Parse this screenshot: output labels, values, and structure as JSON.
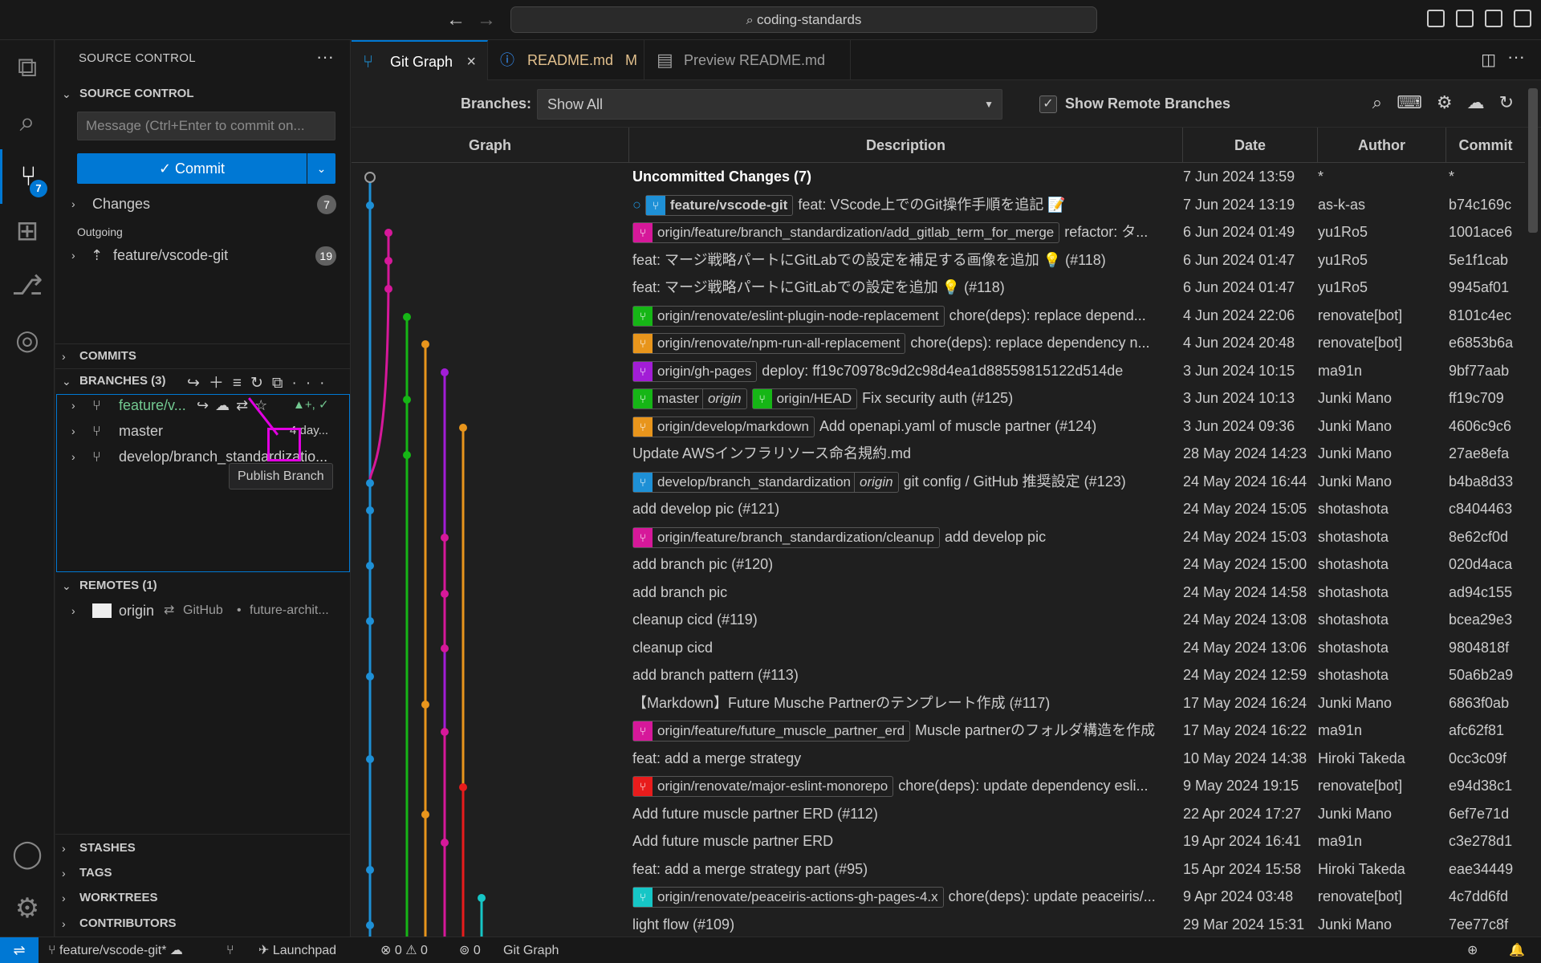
{
  "titlebar": {
    "search": "coding-standards",
    "back": "←",
    "forward": "→"
  },
  "activity": {
    "scm_badge": "7"
  },
  "sidebar": {
    "title": "SOURCE CONTROL",
    "more": "···",
    "section_source_control": "SOURCE CONTROL",
    "message_placeholder": "Message (Ctrl+Enter to commit on...",
    "commit_label": "✓ Commit",
    "changes_label": "Changes",
    "changes_count": "7",
    "outgoing_label": "Outgoing",
    "outgoing_branch": "feature/vscode-git",
    "outgoing_count": "19",
    "commits_label": "COMMITS",
    "branches_label": "BRANCHES (3)",
    "branches": [
      {
        "name": "feature/v...",
        "extra": "▲+, ✓"
      },
      {
        "name": "master",
        "extra": "4 day..."
      },
      {
        "name": "develop/branch_standardizatio...",
        "extra": ""
      }
    ],
    "tooltip": "Publish Branch",
    "remotes_label": "REMOTES (1)",
    "remote_name": "origin",
    "remote_host": "GitHub",
    "remote_owner": "future-archit...",
    "stashes_label": "STASHES",
    "tags_label": "TAGS",
    "worktrees_label": "WORKTREES",
    "contributors_label": "CONTRIBUTORS"
  },
  "tabs": [
    {
      "label": "Git Graph",
      "active": true
    },
    {
      "label": "README.md",
      "modified": "M"
    },
    {
      "label": "Preview README.md"
    }
  ],
  "toolbar": {
    "branches_label": "Branches:",
    "branches_value": "Show All",
    "show_remote_label": "Show Remote Branches"
  },
  "grid": {
    "headers": {
      "graph": "Graph",
      "description": "Description",
      "date": "Date",
      "author": "Author",
      "commit": "Commit"
    },
    "rows": [
      {
        "refs": [],
        "desc": "Uncommitted Changes (7)",
        "date": "7 Jun 2024 13:59",
        "author": "*",
        "commit": "*"
      },
      {
        "refs": [
          {
            "name": "feature/vscode-git",
            "color": "#1e90d6",
            "head": true
          }
        ],
        "desc": "feat: VScode上でのGit操作手順を追記 📝",
        "date": "7 Jun 2024 13:19",
        "author": "as-k-as",
        "commit": "b74c169c"
      },
      {
        "refs": [
          {
            "name": "origin/feature/branch_standardization/add_gitlab_term_for_merge",
            "color": "#d6189a"
          }
        ],
        "desc": "refactor: タ...",
        "date": "6 Jun 2024 01:49",
        "author": "yu1Ro5",
        "commit": "1001ace6"
      },
      {
        "refs": [],
        "desc": "feat: マージ戦略パートにGitLabでの設定を補足する画像を追加 💡 (#118)",
        "date": "6 Jun 2024 01:47",
        "author": "yu1Ro5",
        "commit": "5e1f1cab"
      },
      {
        "refs": [],
        "desc": "feat: マージ戦略パートにGitLabでの設定を追加 💡 (#118)",
        "date": "6 Jun 2024 01:47",
        "author": "yu1Ro5",
        "commit": "9945af01"
      },
      {
        "refs": [
          {
            "name": "origin/renovate/eslint-plugin-node-replacement",
            "color": "#16b616"
          }
        ],
        "desc": "chore(deps): replace depend...",
        "date": "4 Jun 2024 22:06",
        "author": "renovate[bot]",
        "commit": "8101c4ec"
      },
      {
        "refs": [
          {
            "name": "origin/renovate/npm-run-all-replacement",
            "color": "#e8951c"
          }
        ],
        "desc": "chore(deps): replace dependency n...",
        "date": "4 Jun 2024 20:48",
        "author": "renovate[bot]",
        "commit": "e6853b6a"
      },
      {
        "refs": [
          {
            "name": "origin/gh-pages",
            "color": "#a21dd6"
          }
        ],
        "desc": "deploy: ff19c70978c9d2c98d4ea1d88559815122d514de",
        "date": "3 Jun 2024 10:15",
        "author": "ma91n",
        "commit": "9bf77aab"
      },
      {
        "refs": [
          {
            "name": "master",
            "color": "#16b616",
            "remote": "origin"
          },
          {
            "name": "origin/HEAD",
            "color": "#16b616"
          }
        ],
        "desc": "Fix security auth (#125)",
        "date": "3 Jun 2024 10:13",
        "author": "Junki Mano",
        "commit": "ff19c709"
      },
      {
        "refs": [
          {
            "name": "origin/develop/markdown",
            "color": "#e8951c"
          }
        ],
        "desc": "Add openapi.yaml of muscle partner (#124)",
        "date": "3 Jun 2024 09:36",
        "author": "Junki Mano",
        "commit": "4606c9c6"
      },
      {
        "refs": [],
        "desc": "Update AWSインフラリソース命名規約.md",
        "date": "28 May 2024 14:23",
        "author": "Junki Mano",
        "commit": "27ae8efa"
      },
      {
        "refs": [
          {
            "name": "develop/branch_standardization",
            "color": "#1e90d6",
            "remote": "origin"
          }
        ],
        "desc": "git config / GitHub 推奨設定 (#123)",
        "date": "24 May 2024 16:44",
        "author": "Junki Mano",
        "commit": "b4ba8d33"
      },
      {
        "refs": [],
        "desc": "add develop pic (#121)",
        "date": "24 May 2024 15:05",
        "author": "shotashota",
        "commit": "c8404463"
      },
      {
        "refs": [
          {
            "name": "origin/feature/branch_standardization/cleanup",
            "color": "#d6189a"
          }
        ],
        "desc": "add develop pic",
        "date": "24 May 2024 15:03",
        "author": "shotashota",
        "commit": "8e62cf0d"
      },
      {
        "refs": [],
        "desc": "add branch pic (#120)",
        "date": "24 May 2024 15:00",
        "author": "shotashota",
        "commit": "020d4aca"
      },
      {
        "refs": [],
        "desc": "add branch pic",
        "date": "24 May 2024 14:58",
        "author": "shotashota",
        "commit": "ad94c155"
      },
      {
        "refs": [],
        "desc": "cleanup cicd (#119)",
        "date": "24 May 2024 13:08",
        "author": "shotashota",
        "commit": "bcea29e3"
      },
      {
        "refs": [],
        "desc": "cleanup cicd",
        "date": "24 May 2024 13:06",
        "author": "shotashota",
        "commit": "9804818f"
      },
      {
        "refs": [],
        "desc": "add branch pattern (#113)",
        "date": "24 May 2024 12:59",
        "author": "shotashota",
        "commit": "50a6b2a9"
      },
      {
        "refs": [],
        "desc": "【Markdown】Future Musche Partnerのテンプレート作成 (#117)",
        "date": "17 May 2024 16:24",
        "author": "Junki Mano",
        "commit": "6863f0ab"
      },
      {
        "refs": [
          {
            "name": "origin/feature/future_muscle_partner_erd",
            "color": "#d6189a"
          }
        ],
        "desc": "Muscle partnerのフォルダ構造を作成",
        "date": "17 May 2024 16:22",
        "author": "ma91n",
        "commit": "afc62f81"
      },
      {
        "refs": [],
        "desc": "feat: add a merge strategy",
        "date": "10 May 2024 14:38",
        "author": "Hiroki Takeda",
        "commit": "0cc3c09f"
      },
      {
        "refs": [
          {
            "name": "origin/renovate/major-eslint-monorepo",
            "color": "#e81c1c"
          }
        ],
        "desc": "chore(deps): update dependency esli...",
        "date": "9 May 2024 19:15",
        "author": "renovate[bot]",
        "commit": "e94d38c1"
      },
      {
        "refs": [],
        "desc": "Add future muscle partner ERD (#112)",
        "date": "22 Apr 2024 17:27",
        "author": "Junki Mano",
        "commit": "6ef7e71d"
      },
      {
        "refs": [],
        "desc": "Add future muscle partner ERD",
        "date": "19 Apr 2024 16:41",
        "author": "ma91n",
        "commit": "c3e278d1"
      },
      {
        "refs": [],
        "desc": "feat: add a merge strategy part (#95)",
        "date": "15 Apr 2024 15:58",
        "author": "Hiroki Takeda",
        "commit": "eae34449"
      },
      {
        "refs": [
          {
            "name": "origin/renovate/peaceiris-actions-gh-pages-4.x",
            "color": "#16c6c6"
          }
        ],
        "desc": "chore(deps): update peaceiris/...",
        "date": "9 Apr 2024 03:48",
        "author": "renovate[bot]",
        "commit": "4c7dd6fd"
      },
      {
        "refs": [],
        "desc": "light flow (#109)",
        "date": "29 Mar 2024 15:31",
        "author": "Junki Mano",
        "commit": "7ee77c8f"
      }
    ]
  },
  "statusbar": {
    "branch": "feature/vscode-git*",
    "launchpad": "Launchpad",
    "errors": "0",
    "warnings": "0",
    "ports": "0",
    "gitgraph": "Git Graph"
  },
  "colors": {
    "accent": "#0078d4",
    "highlight": "#e100e1"
  }
}
